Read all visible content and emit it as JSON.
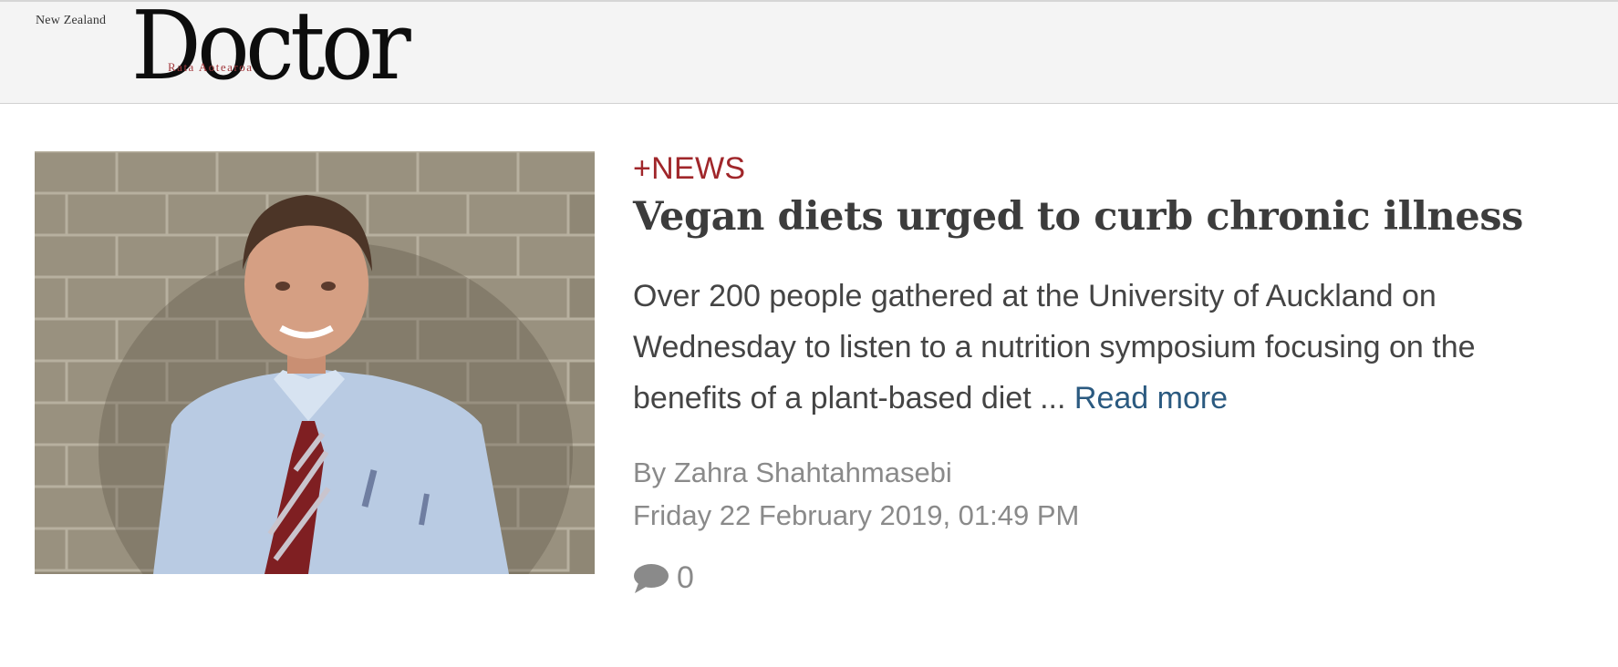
{
  "header": {
    "logo": {
      "kicker": "New Zealand",
      "wordmark": "Doctor",
      "sub": "Rata Aotearoa"
    }
  },
  "article": {
    "category": "+NEWS",
    "headline": "Vegan diets urged to curb chronic illness",
    "excerpt": "Over 200 people gathered at the University of Auckland on Wednesday to listen to a nutrition symposium focusing on the benefits of a plant-based diet ...",
    "read_more": "Read more",
    "byline": "By Zahra Shahtahmasebi",
    "date": "Friday 22 February 2019, 01:49 PM",
    "comment_count": "0"
  },
  "icons": {
    "comment": "speech-bubble-icon"
  },
  "colors": {
    "category": "#a0262a",
    "link": "#2b5a80",
    "headline": "#3c3c3c",
    "meta": "#8a8a8a",
    "header_bg": "#f4f4f4"
  }
}
